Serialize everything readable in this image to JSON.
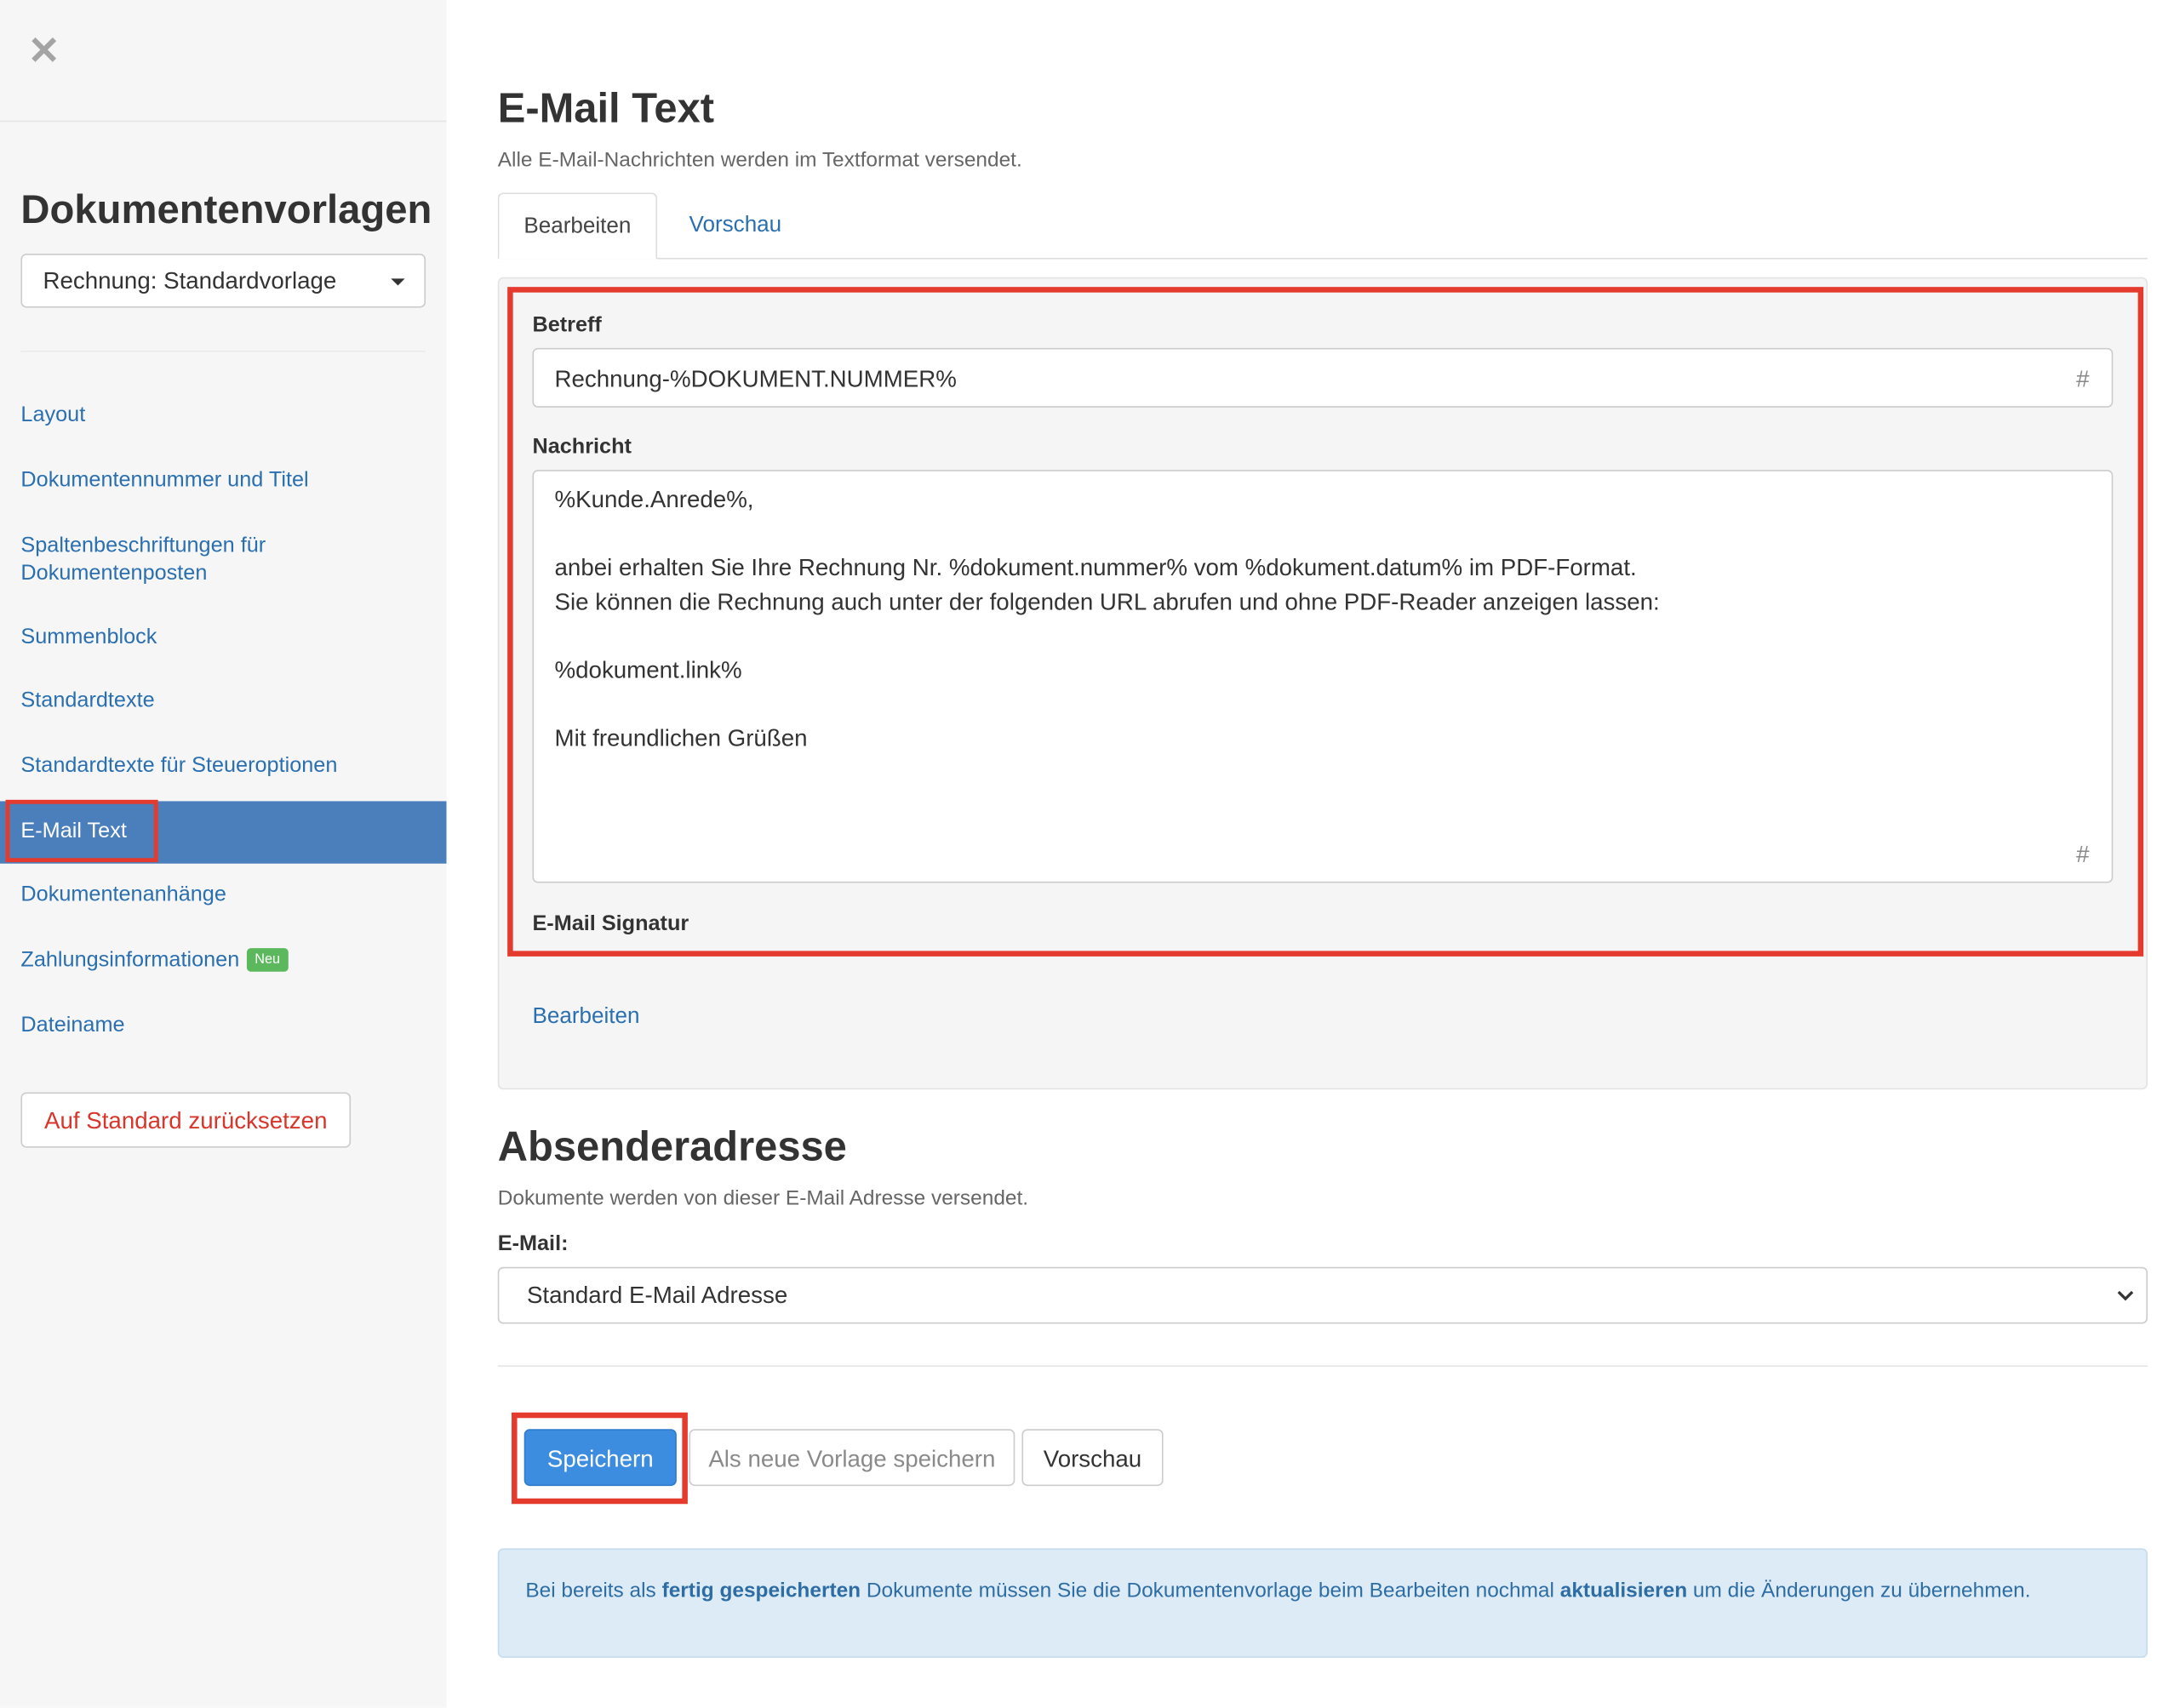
{
  "sidebar": {
    "close_symbol": "✕",
    "title": "Dokumentenvorlagen",
    "template_select": {
      "value": "Rechnung: Standardvorlage"
    },
    "items": [
      {
        "label": "Layout"
      },
      {
        "label": "Dokumentennummer und Titel"
      },
      {
        "label_line1": "Spaltenbeschriftungen für",
        "label_line2": "Dokumentenposten"
      },
      {
        "label": "Summenblock"
      },
      {
        "label": "Standardtexte"
      },
      {
        "label": "Standardtexte für Steueroptionen"
      },
      {
        "label": "E-Mail Text",
        "active": true
      },
      {
        "label": "Dokumentenanhänge"
      },
      {
        "label": "Zahlungsinformationen",
        "badge": "Neu"
      },
      {
        "label": "Dateiname"
      }
    ],
    "reset_button": "Auf Standard zurücksetzen"
  },
  "email_text": {
    "heading": "E-Mail Text",
    "subtitle": "Alle E-Mail-Nachrichten werden im Textformat versendet.",
    "tabs": [
      {
        "label": "Bearbeiten",
        "active": true
      },
      {
        "label": "Vorschau"
      }
    ],
    "subject_label": "Betreff",
    "subject_value": "Rechnung-%DOKUMENT.NUMMER%",
    "hash_symbol": "#",
    "message_label": "Nachricht",
    "message_lines": [
      "%Kunde.Anrede%,",
      "anbei erhalten Sie Ihre Rechnung Nr. %dokument.nummer% vom %dokument.datum% im PDF-Format.",
      "Sie können die Rechnung auch unter der folgenden URL abrufen und ohne PDF-Reader anzeigen lassen:",
      "%dokument.link%",
      "Mit freundlichen Grüßen"
    ],
    "signature_label": "E-Mail Signatur",
    "signature_edit_link": "Bearbeiten"
  },
  "sender": {
    "heading": "Absenderadresse",
    "subtitle": "Dokumente werden von dieser E-Mail Adresse versendet.",
    "email_label": "E-Mail:",
    "email_value": "Standard E-Mail Adresse"
  },
  "actions": {
    "save": "Speichern",
    "save_as_new": "Als neue Vorlage speichern",
    "preview": "Vorschau"
  },
  "info": {
    "text_1": "Bei bereits als ",
    "bold_1": "fertig gespeicherten",
    "text_2": " Dokumente müssen Sie die Dokumentenvorlage beim Bearbeiten nochmal ",
    "bold_2": "aktualisieren",
    "text_3": " um die Änderungen zu übernehmen."
  },
  "colors": {
    "accent": "#3c8de0",
    "active_nav": "#4a7fbb",
    "highlight": "#e53a2e",
    "link": "#2a6fb0",
    "danger": "#d9362b",
    "badge": "#5cb85c"
  }
}
